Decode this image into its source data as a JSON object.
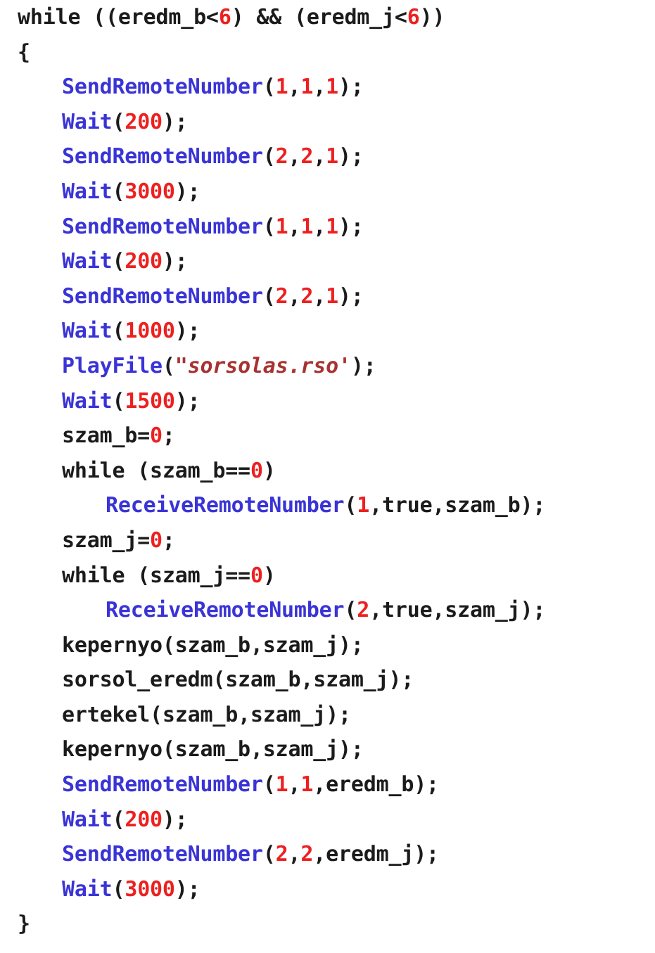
{
  "document": {
    "kind": "source-code-listing",
    "language": "NXC",
    "background_color": "#ffffff",
    "colors": {
      "plain_text": "#1b1b1b",
      "api_function": "#3a34d6",
      "number_literal": "#ed2020",
      "string_literal": "#a83232",
      "punctuation": "#1b1b1b"
    }
  },
  "code": {
    "lines": [
      {
        "indent": 0,
        "tokens": [
          {
            "t": "while ((",
            "c": "plain"
          },
          {
            "t": "eredm_b<",
            "c": "plain"
          },
          {
            "t": "6",
            "c": "num"
          },
          {
            "t": ") && (eredm_j<",
            "c": "plain"
          },
          {
            "t": "6",
            "c": "num"
          },
          {
            "t": "))",
            "c": "plain"
          }
        ]
      },
      {
        "indent": 0,
        "tokens": [
          {
            "t": "{",
            "c": "plain"
          }
        ]
      },
      {
        "indent": 1,
        "tokens": [
          {
            "t": "SendRemoteNumber",
            "c": "api"
          },
          {
            "t": "(",
            "c": "punct"
          },
          {
            "t": "1",
            "c": "num"
          },
          {
            "t": ",",
            "c": "punct"
          },
          {
            "t": "1",
            "c": "num"
          },
          {
            "t": ",",
            "c": "punct"
          },
          {
            "t": "1",
            "c": "num"
          },
          {
            "t": ");",
            "c": "punct"
          }
        ]
      },
      {
        "indent": 1,
        "tokens": [
          {
            "t": "Wait",
            "c": "api"
          },
          {
            "t": "(",
            "c": "punct"
          },
          {
            "t": "200",
            "c": "num"
          },
          {
            "t": ");",
            "c": "punct"
          }
        ]
      },
      {
        "indent": 1,
        "tokens": [
          {
            "t": "SendRemoteNumber",
            "c": "api"
          },
          {
            "t": "(",
            "c": "punct"
          },
          {
            "t": "2",
            "c": "num"
          },
          {
            "t": ",",
            "c": "punct"
          },
          {
            "t": "2",
            "c": "num"
          },
          {
            "t": ",",
            "c": "punct"
          },
          {
            "t": "1",
            "c": "num"
          },
          {
            "t": ");",
            "c": "punct"
          }
        ]
      },
      {
        "indent": 1,
        "tokens": [
          {
            "t": "Wait",
            "c": "api"
          },
          {
            "t": "(",
            "c": "punct"
          },
          {
            "t": "3000",
            "c": "num"
          },
          {
            "t": ");",
            "c": "punct"
          }
        ]
      },
      {
        "indent": 1,
        "tokens": [
          {
            "t": "SendRemoteNumber",
            "c": "api"
          },
          {
            "t": "(",
            "c": "punct"
          },
          {
            "t": "1",
            "c": "num"
          },
          {
            "t": ",",
            "c": "punct"
          },
          {
            "t": "1",
            "c": "num"
          },
          {
            "t": ",",
            "c": "punct"
          },
          {
            "t": "1",
            "c": "num"
          },
          {
            "t": ");",
            "c": "punct"
          }
        ]
      },
      {
        "indent": 1,
        "tokens": [
          {
            "t": "Wait",
            "c": "api"
          },
          {
            "t": "(",
            "c": "punct"
          },
          {
            "t": "200",
            "c": "num"
          },
          {
            "t": ");",
            "c": "punct"
          }
        ]
      },
      {
        "indent": 1,
        "tokens": [
          {
            "t": "SendRemoteNumber",
            "c": "api"
          },
          {
            "t": "(",
            "c": "punct"
          },
          {
            "t": "2",
            "c": "num"
          },
          {
            "t": ",",
            "c": "punct"
          },
          {
            "t": "2",
            "c": "num"
          },
          {
            "t": ",",
            "c": "punct"
          },
          {
            "t": "1",
            "c": "num"
          },
          {
            "t": ");",
            "c": "punct"
          }
        ]
      },
      {
        "indent": 1,
        "tokens": [
          {
            "t": "Wait",
            "c": "api"
          },
          {
            "t": "(",
            "c": "punct"
          },
          {
            "t": "1000",
            "c": "num"
          },
          {
            "t": ");",
            "c": "punct"
          }
        ]
      },
      {
        "indent": 1,
        "tokens": [
          {
            "t": "PlayFile",
            "c": "api"
          },
          {
            "t": "(",
            "c": "punct"
          },
          {
            "t": "\"sorsolas.rso'",
            "c": "str"
          },
          {
            "t": ");",
            "c": "punct"
          }
        ]
      },
      {
        "indent": 1,
        "tokens": [
          {
            "t": "Wait",
            "c": "api"
          },
          {
            "t": "(",
            "c": "punct"
          },
          {
            "t": "1500",
            "c": "num"
          },
          {
            "t": ");",
            "c": "punct"
          }
        ]
      },
      {
        "indent": 1,
        "tokens": [
          {
            "t": "szam_b=",
            "c": "plain"
          },
          {
            "t": "0",
            "c": "num"
          },
          {
            "t": ";",
            "c": "punct"
          }
        ]
      },
      {
        "indent": 1,
        "tokens": [
          {
            "t": "while (szam_b==",
            "c": "plain"
          },
          {
            "t": "0",
            "c": "num"
          },
          {
            "t": ")",
            "c": "punct"
          }
        ]
      },
      {
        "indent": 2,
        "tokens": [
          {
            "t": "ReceiveRemoteNumber",
            "c": "api"
          },
          {
            "t": "(",
            "c": "punct"
          },
          {
            "t": "1",
            "c": "num"
          },
          {
            "t": ",true,szam_b);",
            "c": "plain"
          }
        ]
      },
      {
        "indent": 1,
        "tokens": [
          {
            "t": "szam_j=",
            "c": "plain"
          },
          {
            "t": "0",
            "c": "num"
          },
          {
            "t": ";",
            "c": "punct"
          }
        ]
      },
      {
        "indent": 1,
        "tokens": [
          {
            "t": "while (szam_j==",
            "c": "plain"
          },
          {
            "t": "0",
            "c": "num"
          },
          {
            "t": ")",
            "c": "punct"
          }
        ]
      },
      {
        "indent": 2,
        "tokens": [
          {
            "t": "ReceiveRemoteNumber",
            "c": "api"
          },
          {
            "t": "(",
            "c": "punct"
          },
          {
            "t": "2",
            "c": "num"
          },
          {
            "t": ",true,szam_j);",
            "c": "plain"
          }
        ]
      },
      {
        "indent": 1,
        "tokens": [
          {
            "t": "kepernyo(szam_b,szam_j);",
            "c": "plain"
          }
        ]
      },
      {
        "indent": 1,
        "tokens": [
          {
            "t": "sorsol_eredm(szam_b,szam_j);",
            "c": "plain"
          }
        ]
      },
      {
        "indent": 1,
        "tokens": [
          {
            "t": "ertekel(szam_b,szam_j);",
            "c": "plain"
          }
        ]
      },
      {
        "indent": 1,
        "tokens": [
          {
            "t": "kepernyo(szam_b,szam_j);",
            "c": "plain"
          }
        ]
      },
      {
        "indent": 1,
        "tokens": [
          {
            "t": "SendRemoteNumber",
            "c": "api"
          },
          {
            "t": "(",
            "c": "punct"
          },
          {
            "t": "1",
            "c": "num"
          },
          {
            "t": ",",
            "c": "punct"
          },
          {
            "t": "1",
            "c": "num"
          },
          {
            "t": ",eredm_b);",
            "c": "plain"
          }
        ]
      },
      {
        "indent": 1,
        "tokens": [
          {
            "t": "Wait",
            "c": "api"
          },
          {
            "t": "(",
            "c": "punct"
          },
          {
            "t": "200",
            "c": "num"
          },
          {
            "t": ");",
            "c": "punct"
          }
        ]
      },
      {
        "indent": 1,
        "tokens": [
          {
            "t": "SendRemoteNumber",
            "c": "api"
          },
          {
            "t": "(",
            "c": "punct"
          },
          {
            "t": "2",
            "c": "num"
          },
          {
            "t": ",",
            "c": "punct"
          },
          {
            "t": "2",
            "c": "num"
          },
          {
            "t": ",eredm_j);",
            "c": "plain"
          }
        ]
      },
      {
        "indent": 1,
        "tokens": [
          {
            "t": "Wait",
            "c": "api"
          },
          {
            "t": "(",
            "c": "punct"
          },
          {
            "t": "3000",
            "c": "num"
          },
          {
            "t": ");",
            "c": "punct"
          }
        ]
      },
      {
        "indent": 0,
        "tokens": [
          {
            "t": "}",
            "c": "plain"
          }
        ]
      }
    ]
  }
}
